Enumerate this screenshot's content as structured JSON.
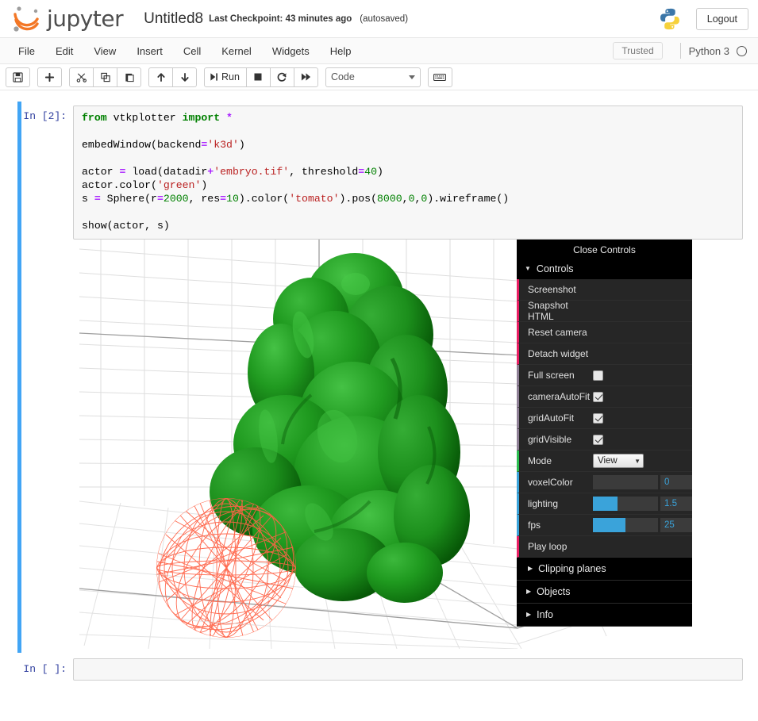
{
  "header": {
    "brand": "jupyter",
    "notebook_name": "Untitled8",
    "checkpoint": "Last Checkpoint: 43 minutes ago",
    "autosaved": "(autosaved)",
    "logout_label": "Logout",
    "python_logo_icon": "python-logo-icon",
    "accent_orange": "#f37726",
    "accent_gray": "#9e9e9e"
  },
  "menubar": {
    "items": [
      "File",
      "Edit",
      "View",
      "Insert",
      "Cell",
      "Kernel",
      "Widgets",
      "Help"
    ],
    "trusted_label": "Trusted",
    "kernel_name": "Python 3",
    "kernel_indicator_icon": "kernel-idle-circle-icon"
  },
  "toolbar": {
    "save_icon": "save-floppy-icon",
    "insert_icon": "plus-icon",
    "cut_icon": "scissors-icon",
    "copy_icon": "copy-icon",
    "paste_icon": "paste-icon",
    "moveup_icon": "arrow-up-icon",
    "movedown_icon": "arrow-down-icon",
    "run_label": "Run",
    "run_icon": "run-step-icon",
    "stop_icon": "stop-square-icon",
    "restart_icon": "restart-circle-icon",
    "restart_runall_icon": "fast-forward-icon",
    "celltype_value": "Code",
    "command_palette_icon": "keyboard-icon"
  },
  "cells": [
    {
      "prompt": "In [2]:",
      "code_lines": [
        "from vtkplotter import *",
        "",
        "embedWindow(backend='k3d')",
        "",
        "actor = load(datadir+'embryo.tif', threshold=40)",
        "actor.color('green')",
        "s = Sphere(r=2000, res=10).color('tomato').pos(8000,0,0).wireframe()",
        "",
        "show(actor, s)"
      ]
    },
    {
      "prompt": "In [ ]:",
      "code_lines": [
        ""
      ]
    }
  ],
  "k3d": {
    "close_controls_label": "Close Controls",
    "controls_section_label": "Controls",
    "buttons": [
      {
        "label": "Screenshot"
      },
      {
        "label": "Snapshot HTML"
      },
      {
        "label": "Reset camera"
      },
      {
        "label": "Detach widget"
      }
    ],
    "checkboxes": [
      {
        "label": "Full screen",
        "checked": false
      },
      {
        "label": "cameraAutoFit",
        "checked": true
      },
      {
        "label": "gridAutoFit",
        "checked": true
      },
      {
        "label": "gridVisible",
        "checked": true
      }
    ],
    "mode": {
      "label": "Mode",
      "value": "View"
    },
    "sliders": [
      {
        "label": "voxelColor",
        "value": "0",
        "fill_percent": 0
      },
      {
        "label": "lighting",
        "value": "1.5",
        "fill_percent": 38
      },
      {
        "label": "fps",
        "value": "25",
        "fill_percent": 50
      }
    ],
    "play_loop_label": "Play loop",
    "sections": [
      {
        "label": "Clipping planes",
        "nested": true
      },
      {
        "label": "Objects",
        "nested": false
      },
      {
        "label": "Info",
        "nested": false
      }
    ],
    "colors": {
      "panel_bg": "#1a1a1a",
      "row_bg": "#262626",
      "button_accent": "#e91e63",
      "checkbox_accent": "#8e7f95",
      "select_accent": "#2bbd4f",
      "slider_accent": "#3aa3da"
    }
  },
  "scene": {
    "mesh_color": "#1a8c1a",
    "wireframe_color": "#ff6347",
    "grid_color": "#d8d8d8",
    "axis_color": "#9a9a9a",
    "background": "#ffffff",
    "objects": [
      "embryo-isosurface",
      "wireframe-sphere"
    ]
  }
}
